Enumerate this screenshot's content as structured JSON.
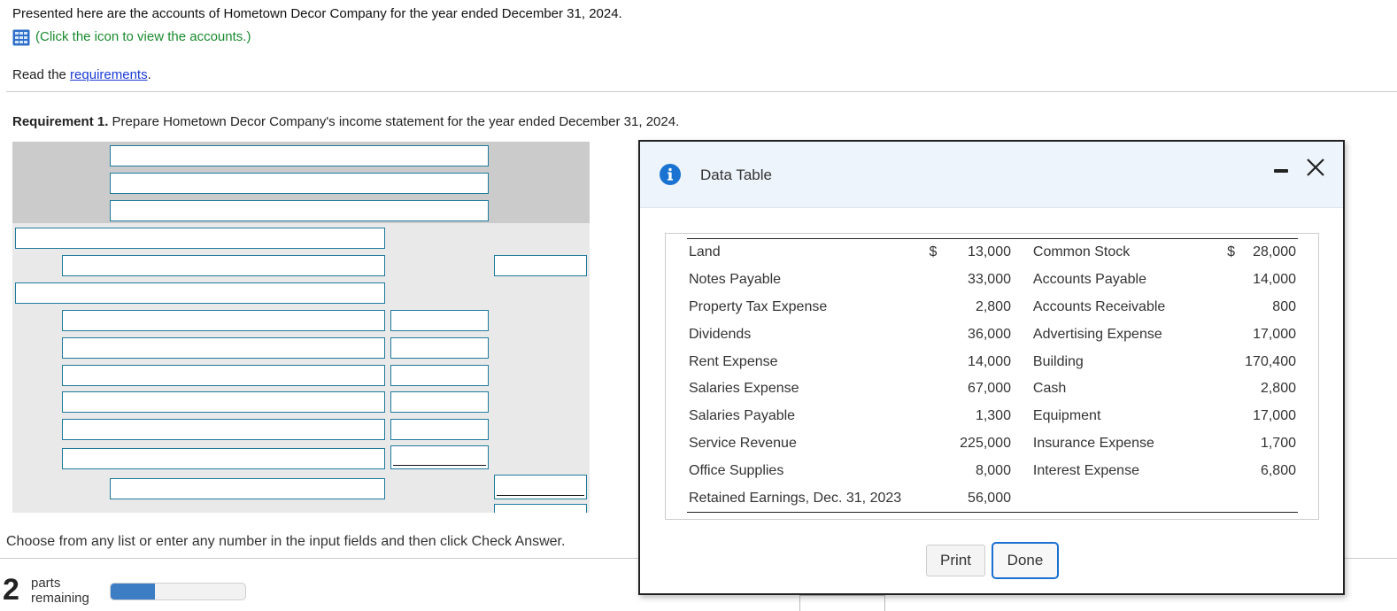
{
  "intro": {
    "text": "Presented here are the accounts of Hometown Decor Company for the year ended December 31, 2024.",
    "view_link": "(Click the icon to view the accounts.)",
    "read_prefix": "Read the ",
    "read_link": "requirements",
    "read_suffix": "."
  },
  "requirement": {
    "label": "Requirement 1.",
    "text": " Prepare Hometown Decor Company's income statement for the year ended December 31, 2024."
  },
  "footer": {
    "choose_text": "Choose from any list or enter any number in the input fields and then click Check Answer.",
    "parts_count": "2",
    "parts_label_1": "parts",
    "parts_label_2": "remaining",
    "progress_fraction": 0.33
  },
  "modal": {
    "title": "Data Table",
    "print_label": "Print",
    "done_label": "Done",
    "rows": [
      {
        "left_name": "Land",
        "left_cur": "$",
        "left_val": "13,000",
        "right_name": "Common Stock",
        "right_cur": "$",
        "right_val": "28,000"
      },
      {
        "left_name": "Notes Payable",
        "left_cur": "",
        "left_val": "33,000",
        "right_name": "Accounts Payable",
        "right_cur": "",
        "right_val": "14,000"
      },
      {
        "left_name": "Property Tax Expense",
        "left_cur": "",
        "left_val": "2,800",
        "right_name": "Accounts Receivable",
        "right_cur": "",
        "right_val": "800"
      },
      {
        "left_name": "Dividends",
        "left_cur": "",
        "left_val": "36,000",
        "right_name": "Advertising Expense",
        "right_cur": "",
        "right_val": "17,000"
      },
      {
        "left_name": "Rent Expense",
        "left_cur": "",
        "left_val": "14,000",
        "right_name": "Building",
        "right_cur": "",
        "right_val": "170,400"
      },
      {
        "left_name": "Salaries Expense",
        "left_cur": "",
        "left_val": "67,000",
        "right_name": "Cash",
        "right_cur": "",
        "right_val": "2,800"
      },
      {
        "left_name": "Salaries Payable",
        "left_cur": "",
        "left_val": "1,300",
        "right_name": "Equipment",
        "right_cur": "",
        "right_val": "17,000"
      },
      {
        "left_name": "Service Revenue",
        "left_cur": "",
        "left_val": "225,000",
        "right_name": "Insurance Expense",
        "right_cur": "",
        "right_val": "1,700"
      },
      {
        "left_name": "Office Supplies",
        "left_cur": "",
        "left_val": "8,000",
        "right_name": "Interest Expense",
        "right_cur": "",
        "right_val": "6,800"
      },
      {
        "left_name": "Retained Earnings, Dec. 31, 2023",
        "left_cur": "",
        "left_val": "56,000",
        "right_name": "",
        "right_cur": "",
        "right_val": ""
      }
    ]
  },
  "colors": {
    "link_green": "#1a8a2e",
    "link_blue": "#1a3bd6",
    "input_border": "#1f7a9c",
    "info_blue": "#1a73d0",
    "progress_fill": "#3d7dc4"
  }
}
